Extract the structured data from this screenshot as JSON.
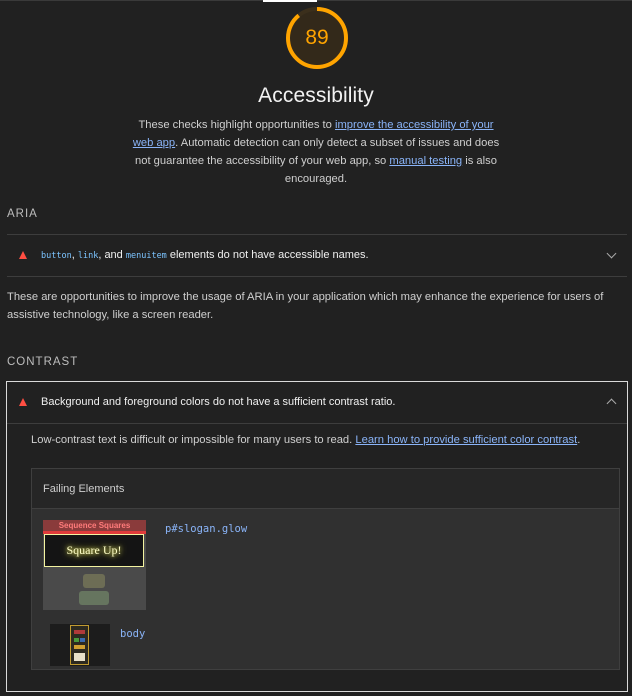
{
  "score": "89",
  "title": "Accessibility",
  "description": {
    "part1": "These checks highlight opportunities to ",
    "link1": "improve the accessibility of your web app",
    "part2": ". Automatic detection can only detect a subset of issues and does not guarantee the accessibility of your web app, so ",
    "link2": "manual testing",
    "part3": " is also encouraged."
  },
  "aria": {
    "group_title": "ARIA",
    "audit": {
      "code1": "button",
      "sep1": ", ",
      "code2": "link",
      "sep2": ", and ",
      "code3": "menuitem",
      "rest": " elements do not have accessible names."
    },
    "description": "These are opportunities to improve the usage of ARIA in your application which may enhance the experience for users of assistive technology, like a screen reader."
  },
  "contrast": {
    "group_title": "CONTRAST",
    "audit_title": "Background and foreground colors do not have a sufficient contrast ratio.",
    "desc_text": "Low-contrast text is difficult or impossible for many users to read. ",
    "desc_link": "Learn how to provide sufficient color contrast",
    "desc_end": ".",
    "table_header": "Failing Elements",
    "items": [
      {
        "selector": "p#slogan.glow",
        "thumb_header": "Sequence Squares",
        "thumb_text": "Square Up!"
      },
      {
        "selector": "body"
      }
    ]
  },
  "colors": {
    "score": "#ffa400",
    "fail": "#ff4e42",
    "link": "#8ab4f8",
    "background": "#212121"
  }
}
